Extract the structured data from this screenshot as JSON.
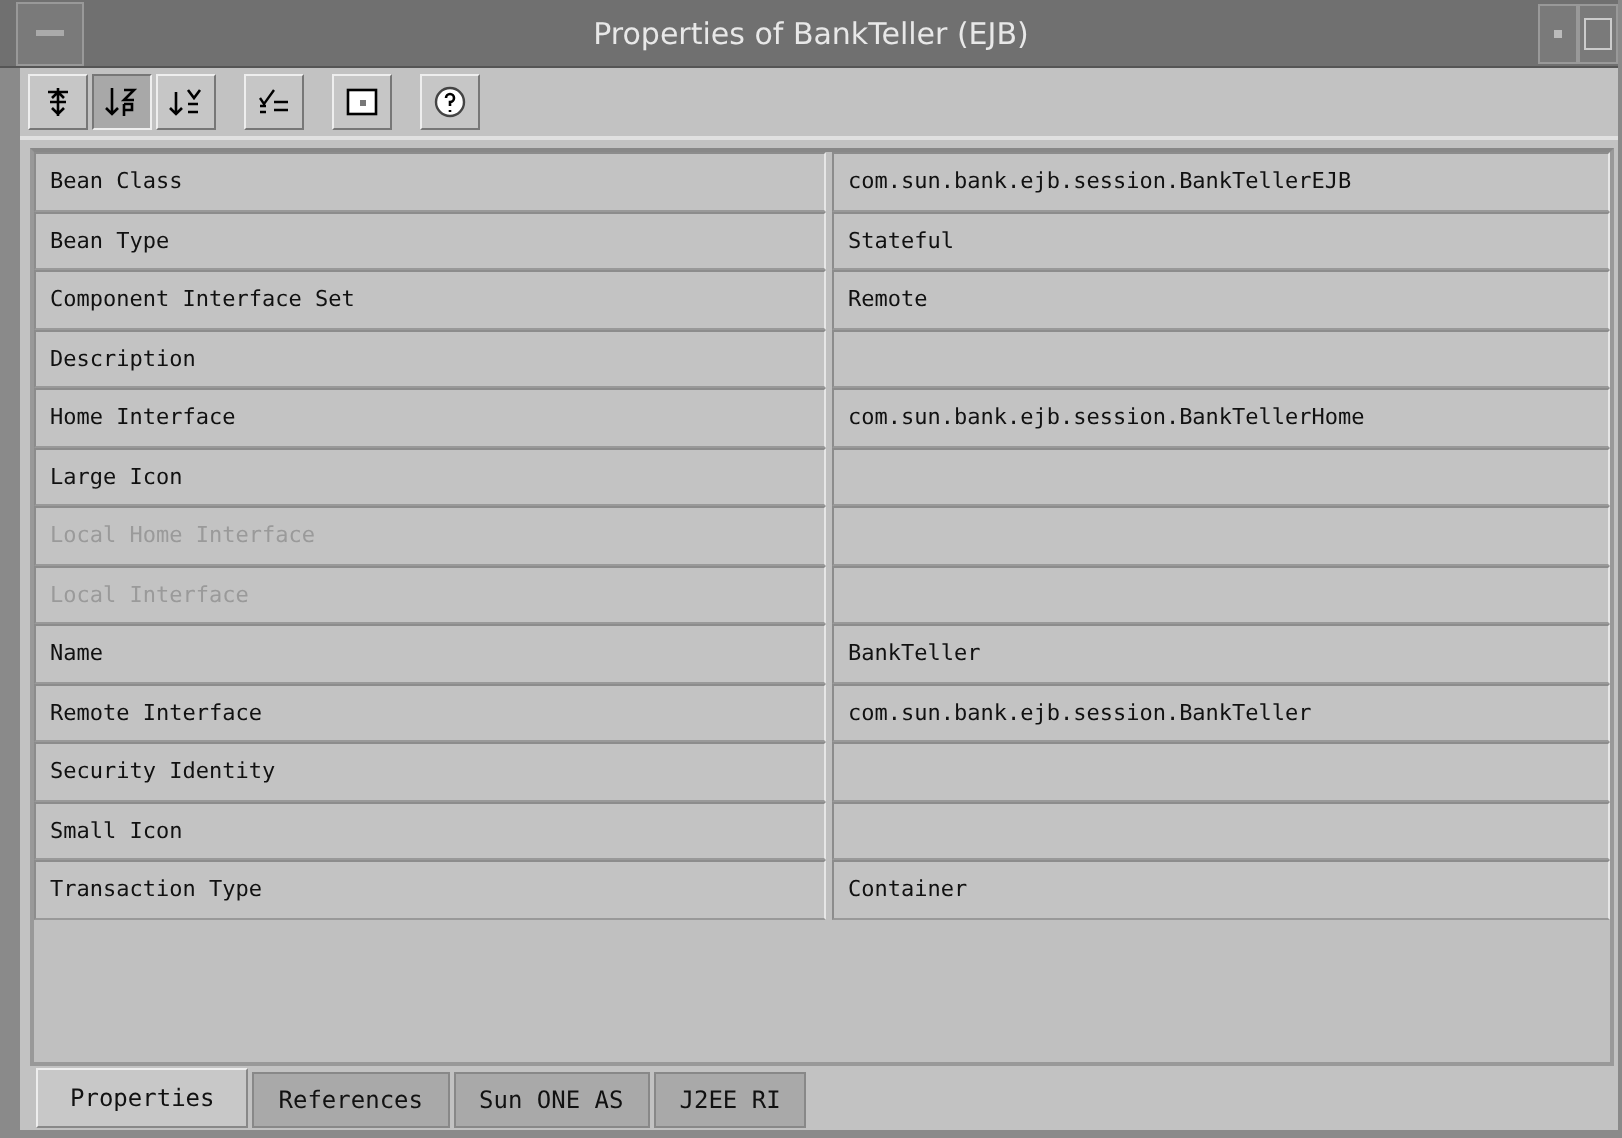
{
  "window": {
    "title": "Properties of BankTeller (EJB)"
  },
  "toolbar": [
    {
      "selected": false
    },
    {
      "selected": true
    },
    {
      "selected": false
    },
    {
      "selected": false
    },
    {
      "selected": false
    },
    {
      "selected": false
    }
  ],
  "properties": [
    {
      "name": "Bean Class",
      "value": "com.sun.bank.ejb.session.BankTellerEJB",
      "disabled": false
    },
    {
      "name": "Bean Type",
      "value": "Stateful",
      "disabled": false
    },
    {
      "name": "Component Interface Set",
      "value": "Remote",
      "disabled": false
    },
    {
      "name": "Description",
      "disabled": false
    },
    {
      "name": "Home Interface",
      "value": "com.sun.bank.ejb.session.BankTellerHome",
      "disabled": false
    },
    {
      "name": "Large Icon",
      "disabled": false
    },
    {
      "name": "Local Home Interface",
      "disabled": true
    },
    {
      "name": "Local Interface",
      "disabled": true
    },
    {
      "name": "Name",
      "value": "BankTeller",
      "disabled": false
    },
    {
      "name": "Remote Interface",
      "value": "com.sun.bank.ejb.session.BankTeller",
      "disabled": false
    },
    {
      "name": "Security Identity",
      "disabled": false
    },
    {
      "name": "Small Icon",
      "disabled": false
    },
    {
      "name": "Transaction Type",
      "value": "Container",
      "disabled": false
    }
  ],
  "tabs": [
    {
      "label": "Properties",
      "selected": true
    },
    {
      "label": "References",
      "selected": false
    },
    {
      "label": "Sun ONE AS",
      "selected": false
    },
    {
      "label": "J2EE RI",
      "selected": false
    }
  ]
}
